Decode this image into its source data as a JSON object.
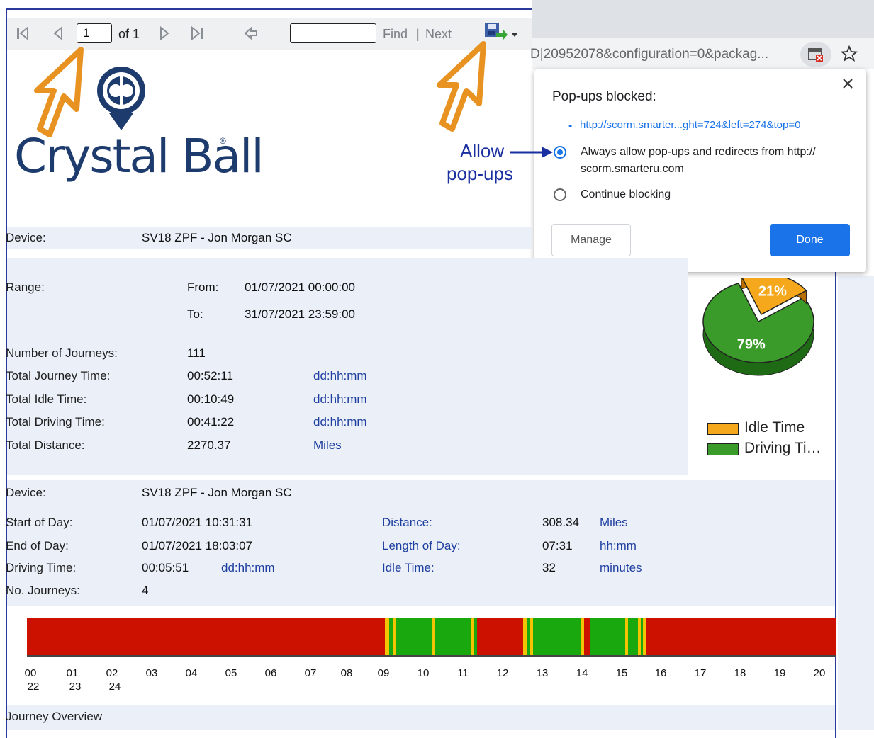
{
  "toolbar": {
    "page_value": "1",
    "page_of": "of 1",
    "find_label": "Find",
    "separator": "|",
    "next_label": "Next"
  },
  "browser": {
    "url_fragment": "D|20952078&configuration=0&packag..."
  },
  "popup": {
    "title": "Pop-ups blocked:",
    "blocked_link": "http://scorm.smarter...ght=724&left=274&top=0",
    "option_allow_line1": "Always allow pop-ups and redirects from http://",
    "option_allow_line2": "scorm.smarteru.com",
    "option_block": "Continue blocking",
    "manage_label": "Manage",
    "done_label": "Done",
    "selected_option": "allow"
  },
  "annotation": {
    "line1": "Allow",
    "line2": "pop-ups"
  },
  "logo": {
    "text": "Crystal Ball",
    "mark": "®"
  },
  "summary": {
    "device_label": "Device:",
    "device_value": "SV18 ZPF - Jon Morgan SC",
    "range_label": "Range:",
    "from_label": "From:",
    "from_value": "01/07/2021 00:00:00",
    "to_label": "To:",
    "to_value": "31/07/2021 23:59:00",
    "rows": [
      {
        "label": "Number of Journeys:",
        "value": "111",
        "unit": ""
      },
      {
        "label": "Total Journey Time:",
        "value": "00:52:11",
        "unit": "dd:hh:mm"
      },
      {
        "label": "Total Idle Time:",
        "value": "00:10:49",
        "unit": "dd:hh:mm"
      },
      {
        "label": "Total Driving Time:",
        "value": "00:41:22",
        "unit": "dd:hh:mm"
      },
      {
        "label": "Total Distance:",
        "value": "2270.37",
        "unit": "Miles"
      }
    ]
  },
  "day": {
    "device_label": "Device:",
    "device_value": "SV18 ZPF - Jon Morgan SC",
    "start_label": "Start of Day:",
    "start_value": "01/07/2021 10:31:31",
    "end_label": "End of Day:",
    "end_value": "01/07/2021 18:03:07",
    "driving_label": "Driving Time:",
    "driving_value": "00:05:51",
    "driving_unit": "dd:hh:mm",
    "journeys_label": "No. Journeys:",
    "journeys_value": "4",
    "distance_label": "Distance:",
    "distance_value": "308.34",
    "distance_unit": "Miles",
    "length_label": "Length of Day:",
    "length_value": "07:31",
    "length_unit": "hh:mm",
    "idle_label": "Idle Time:",
    "idle_value": "32",
    "idle_unit": "minutes"
  },
  "timeline": {
    "ticks_top": [
      "00",
      "01",
      "02",
      "03",
      "04",
      "05",
      "06",
      "07",
      "08",
      "09",
      "10",
      "11",
      "12",
      "13",
      "14",
      "15",
      "16",
      "17",
      "18",
      "19",
      "20"
    ],
    "ticks_bottom": [
      "22",
      "23",
      "24"
    ],
    "colors": {
      "stopped": "#cc1100",
      "driving": "#1aa80f",
      "idle": "#f5c400"
    }
  },
  "footer": {
    "journey_overview": "Journey Overview"
  },
  "chart_data": {
    "type": "pie",
    "title": "",
    "slices": [
      {
        "label": "Driving Ti…",
        "value": 79,
        "display": "79%",
        "color": "#3a9a2a"
      },
      {
        "label": "Idle Time",
        "value": 21,
        "display": "21%",
        "color": "#f5a81c"
      }
    ],
    "legend": [
      {
        "label": "Idle Time",
        "color": "#f5a81c"
      },
      {
        "label": "Driving Ti…",
        "color": "#3a9a2a"
      }
    ],
    "legend_position": "bottom"
  }
}
